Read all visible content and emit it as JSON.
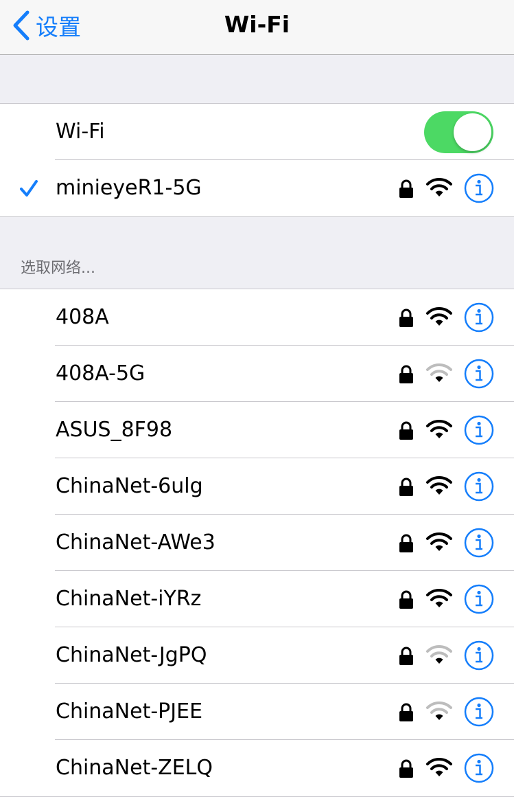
{
  "nav": {
    "back_label": "设置",
    "title": "Wi-Fi"
  },
  "wifi_toggle": {
    "label": "Wi-Fi",
    "on": true,
    "color": "#4cd964"
  },
  "connected": {
    "name": "minieyeR1-5G",
    "secured": true,
    "signal": "full"
  },
  "section": {
    "header": "选取网络..."
  },
  "networks": [
    {
      "name": "408A",
      "secured": true,
      "signal": "full"
    },
    {
      "name": "408A-5G",
      "secured": true,
      "signal": "weak"
    },
    {
      "name": "ASUS_8F98",
      "secured": true,
      "signal": "full"
    },
    {
      "name": "ChinaNet-6ulg",
      "secured": true,
      "signal": "full"
    },
    {
      "name": "ChinaNet-AWe3",
      "secured": true,
      "signal": "full"
    },
    {
      "name": "ChinaNet-iYRz",
      "secured": true,
      "signal": "full"
    },
    {
      "name": "ChinaNet-JgPQ",
      "secured": true,
      "signal": "weak"
    },
    {
      "name": "ChinaNet-PJEE",
      "secured": true,
      "signal": "weak"
    },
    {
      "name": "ChinaNet-ZELQ",
      "secured": true,
      "signal": "full"
    }
  ],
  "colors": {
    "accent": "#157efb",
    "background": "#efeff4"
  },
  "icons": {
    "back": "chevron-left-icon",
    "check": "checkmark-icon",
    "lock": "lock-icon",
    "wifi": "wifi-signal-icon",
    "info": "info-icon"
  }
}
